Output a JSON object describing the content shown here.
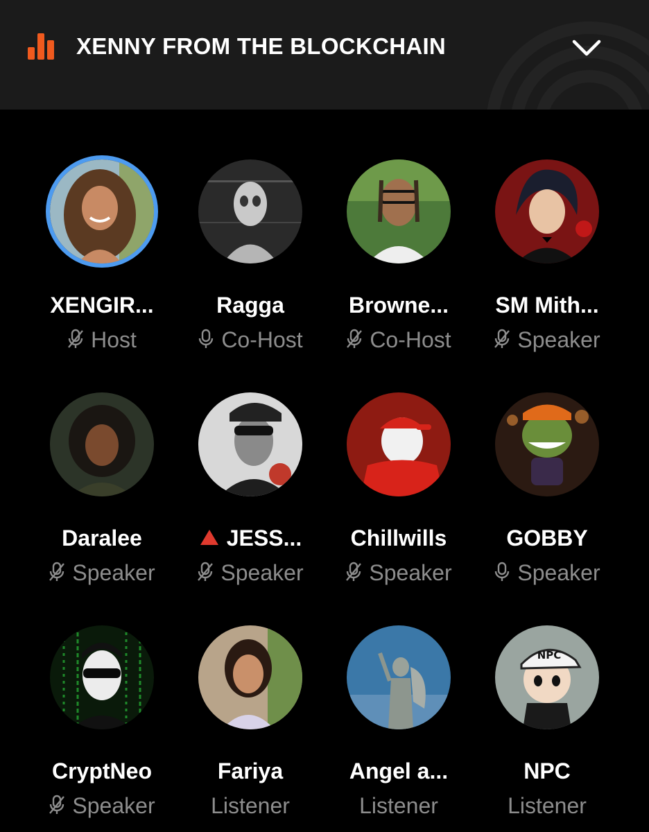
{
  "header": {
    "title": "XENNY FROM THE BLOCKCHAIN",
    "icons": {
      "leading": "audio-bars-icon",
      "trailing": "chevron-down-icon"
    },
    "accent_color": "#f05a1e"
  },
  "participants": [
    {
      "name": "XENGIR...",
      "role": "Host",
      "mic": "muted",
      "ring_color": "#4d9bf0"
    },
    {
      "name": "Ragga",
      "role": "Co-Host",
      "mic": "on"
    },
    {
      "name": "Browne...",
      "role": "Co-Host",
      "mic": "muted"
    },
    {
      "name": "SM Mith...",
      "role": "Speaker",
      "mic": "muted"
    },
    {
      "name": "Daralee",
      "role": "Speaker",
      "mic": "muted"
    },
    {
      "name": "JESS...",
      "role": "Speaker",
      "mic": "muted",
      "name_prefix_icon": "red-triangle-icon"
    },
    {
      "name": "Chillwills",
      "role": "Speaker",
      "mic": "muted"
    },
    {
      "name": "GOBBY",
      "role": "Speaker",
      "mic": "on"
    },
    {
      "name": "CryptNeo",
      "role": "Speaker",
      "mic": "muted"
    },
    {
      "name": "Fariya",
      "role": "Listener",
      "mic": "none"
    },
    {
      "name": "Angel a...",
      "role": "Listener",
      "mic": "none"
    },
    {
      "name": "NPC",
      "role": "Listener",
      "mic": "none",
      "avatar_text": "NPC"
    }
  ]
}
